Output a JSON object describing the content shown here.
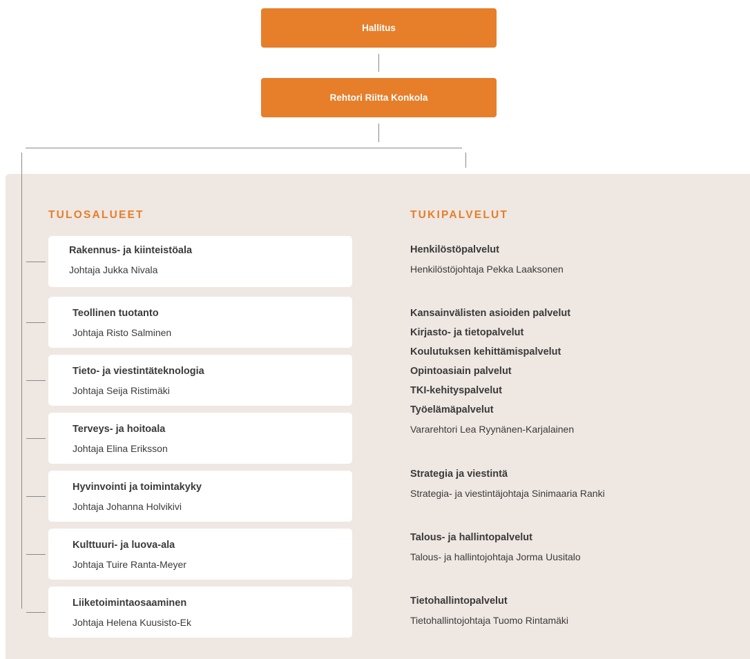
{
  "board": {
    "label": "Hallitus"
  },
  "rector": {
    "label": "Rehtori Riitta Konkola"
  },
  "sections": {
    "left_title": "TULOSALUEET",
    "right_title": "TUKIPALVELUT"
  },
  "units": [
    {
      "name": "Rakennus- ja kiinteistöala",
      "head": "Johtaja Jukka Nivala"
    },
    {
      "name": "Teollinen tuotanto",
      "head": "Johtaja Risto Salminen"
    },
    {
      "name": "Tieto- ja viestintäteknologia",
      "head": "Johtaja Seija Ristimäki"
    },
    {
      "name": "Terveys- ja hoitoala",
      "head": "Johtaja Elina Eriksson"
    },
    {
      "name": "Hyvinvointi ja toimintakyky",
      "head": "Johtaja Johanna Holvikivi"
    },
    {
      "name": "Kulttuuri- ja luova-ala",
      "head": "Johtaja Tuire Ranta-Meyer"
    },
    {
      "name": "Liiketoimintaosaaminen",
      "head": "Johtaja Helena Kuusisto-Ek"
    }
  ],
  "services": {
    "hr": {
      "name": "Henkilöstöpalvelut",
      "head": "Henkilöstöjohtaja Pekka Laaksonen"
    },
    "group": [
      "Kansainvälisten asioiden palvelut",
      "Kirjasto- ja tietopalvelut",
      "Koulutuksen kehittämispalvelut",
      "Opintoasiain palvelut",
      "TKI-kehityspalvelut",
      "Työelämäpalvelut"
    ],
    "group_head": "Vararehtori Lea Ryynänen-Karjalainen",
    "strategy": {
      "name": "Strategia ja viestintä",
      "head": "Strategia- ja viestintäjohtaja Sinimaaria Ranki"
    },
    "finance": {
      "name": "Talous- ja hallintopalvelut",
      "head": "Talous- ja hallintojohtaja Jorma Uusitalo"
    },
    "it": {
      "name": "Tietohallintopalvelut",
      "head": "Tietohallintojohtaja Tuomo Rintamäki"
    }
  },
  "colors": {
    "accent": "#e67e2a",
    "panel": "#efe7e2",
    "line": "#888888"
  }
}
